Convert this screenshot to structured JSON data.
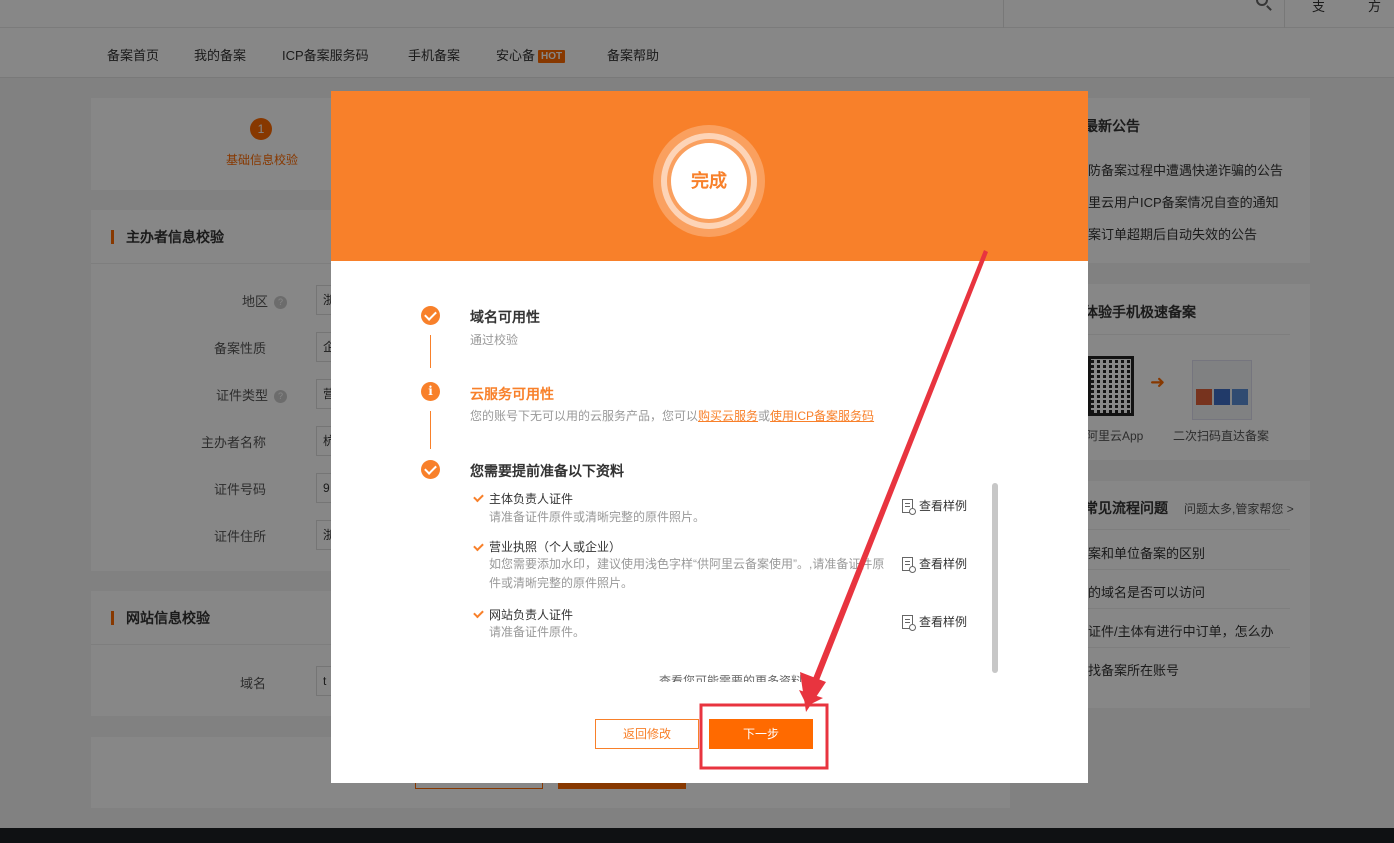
{
  "topbar": {
    "link_1": "支",
    "link_2": "方"
  },
  "nav": {
    "items": [
      "备案首页",
      "我的备案",
      "ICP备案服务码",
      "手机备案",
      "安心备",
      "备案帮助"
    ],
    "hot_badge": "HOT"
  },
  "steps": {
    "step1_number": "1",
    "step1_label": "基础信息校验"
  },
  "sponsor_section": {
    "title": "主办者信息校验",
    "fields": [
      {
        "label": "地区",
        "help": "?",
        "value": "浙"
      },
      {
        "label": "备案性质",
        "value": "企"
      },
      {
        "label": "证件类型",
        "help": "?",
        "value": "营"
      },
      {
        "label": "主办者名称",
        "value": "杭"
      },
      {
        "label": "证件号码",
        "value": "9"
      },
      {
        "label": "证件住所",
        "value": "浙"
      }
    ]
  },
  "website_section": {
    "title": "网站信息校验",
    "domain_label": "域名",
    "domain_value": "t"
  },
  "sidebar": {
    "announcements_title": "最新公告",
    "announcements": [
      "防备案过程中遭遇快递诈骗的公告",
      "里云用户ICP备案情况自查的通知",
      "案订单超期后自动失效的公告"
    ],
    "mobile_title": "体验手机极速备案",
    "mobile_app_label": "阿里云App",
    "mobile_scan_label": "二次扫码直达备案",
    "faq_title": "常见流程问题",
    "faq_more": "问题太多,管家帮您",
    "faq_items": [
      "案和单位备案的区别",
      "的域名是否可以访问",
      "证件/主体有进行中订单，怎么办",
      "找备案所在账号"
    ]
  },
  "modal": {
    "status": "完成",
    "items": [
      {
        "title": "域名可用性",
        "desc": "通过校验"
      },
      {
        "title": "云服务可用性",
        "desc_prefix": "您的账号下无可以用的云服务产品，您可以",
        "link_buy": "购买云服务",
        "desc_or": "或",
        "link_code": "使用ICP备案服务码"
      },
      {
        "title": "您需要提前准备以下资料"
      }
    ],
    "materials": [
      {
        "title": "主体负责人证件",
        "desc": "请准备证件原件或清晰完整的原件照片。",
        "sample": "查看样例"
      },
      {
        "title": "营业执照（个人或企业）",
        "desc": "如您需要添加水印，建议使用浅色字样“供阿里云备案使用”。,请准备证件原件或清晰完整的原件照片。",
        "sample": "查看样例"
      },
      {
        "title": "网站负责人证件",
        "desc": "请准备证件原件。",
        "sample": "查看样例"
      }
    ],
    "more_materials": "查看您可能需要的更多资料",
    "back_button": "返回修改",
    "next_button": "下一步"
  },
  "colors": {
    "brand_orange": "#f8802a",
    "button_orange": "#ff6a00",
    "annotation_red": "#e8343f"
  }
}
